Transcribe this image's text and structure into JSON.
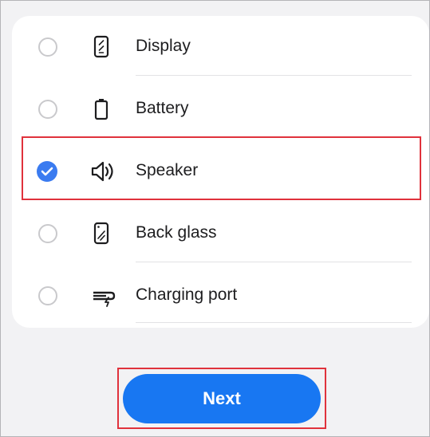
{
  "options": [
    {
      "label": "Display",
      "icon": "phone-display-icon",
      "checked": false
    },
    {
      "label": "Battery",
      "icon": "battery-icon",
      "checked": false
    },
    {
      "label": "Speaker",
      "icon": "speaker-icon",
      "checked": true
    },
    {
      "label": "Back glass",
      "icon": "back-glass-icon",
      "checked": false
    },
    {
      "label": "Charging port",
      "icon": "charging-port-icon",
      "checked": false
    }
  ],
  "next_button": {
    "label": "Next"
  },
  "colors": {
    "accent": "#3a7bf0",
    "button": "#1877f2",
    "highlight": "#e0323c",
    "background": "#f2f2f4",
    "card": "#ffffff"
  }
}
